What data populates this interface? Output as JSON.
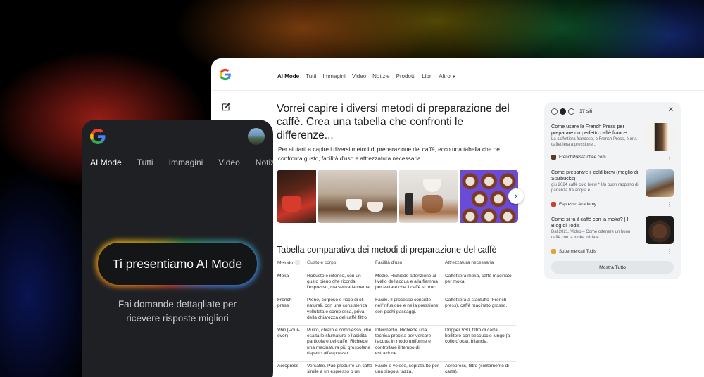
{
  "colors": {
    "accent_blue": "#4285f4",
    "accent_red": "#ea4335",
    "accent_yellow": "#fbbc04",
    "accent_green": "#34a853",
    "phone_bg": "#1f2023"
  },
  "desktop": {
    "nav_tabs": [
      "AI Mode",
      "Tutti",
      "Immagini",
      "Video",
      "Notizie",
      "Prodotti",
      "Libri",
      "Altro"
    ],
    "question": "Vorrei capire i diversi metodi di preparazione del caffè. Crea una tabella che confronti le differenze...",
    "intro": "Per aiutarti a capire i diversi metodi di preparazione del caffè, ecco una tabella che ne confronta gusto, facilità d'uso e attrezzatura necessaria.",
    "next_icon": "chevron-right-icon",
    "table_title": "Tabella comparativa dei metodi di preparazione del caffè",
    "table": {
      "headers": [
        "Metodo",
        "Gusto e corpo",
        "Facilità d'uso",
        "Attrezzatura necessaria"
      ],
      "rows": [
        [
          "Moka",
          "Robusto e intenso, con un gusto pieno che ricorda l'espresso, ma senza la crema.",
          "Medio. Richiede attenzione al livello dell'acqua e alla fiamma per evitare che il caffè si bruci.",
          "Caffettiera moka, caffè macinato per moka."
        ],
        [
          "French press",
          "Pieno, corposo e ricco di oli naturali, con una consistenza vellutata e complessa, priva della chiarezza del caffè filtro.",
          "Facile. Il processo consiste nell'infusione e nella pressione, con pochi passaggi.",
          "Caffettiera a stantuffo (French press), caffè macinato grosso."
        ],
        [
          "V60 (Pour-over)",
          "Pulito, chiaro e complesso, che esalta le sfumature e l'acidità particolare del caffè. Richiede una macinatura più grossolana rispetto all'espresso.",
          "Intermedio. Richiede una tecnica precisa per versare l'acqua in modo uniforme e controllare il tempo di estrazione.",
          "Dripper V60, filtro di carta, bollitore con beccuccio lungo (a collo d'oca), bilancia."
        ],
        [
          "Aeropress",
          "Versatile. Può produrre un caffè simile a un espresso o un",
          "Facile e veloce, soprattutto per una singola tazza.",
          "Aeropress, filtro (solitamente di carta)."
        ]
      ]
    },
    "sources": {
      "count_label": "17 siti",
      "items": [
        {
          "title": "Come usare la French Press per preparare un perfetto caffè france..",
          "snippet": "La caffettiera francese, o French Press, è una caffettiera a pressione...",
          "site": "FrenchPressCoffee.com"
        },
        {
          "title": "Come preparare il cold brew (meglio di Starbucks)",
          "snippet": "giu 2024 caffè cold brew * Un buon rapporto di partenza fra acqua e...",
          "site": "Espresso Academy..."
        },
        {
          "title": "Come si fa il caffè con la moka? | Il Blog di Todis",
          "snippet": "Dal 2021. Video – Come ottenere un buon caffè con la moka Iniziate...",
          "site": "Supermercati Todis"
        }
      ],
      "show_all": "Mostra Tutto"
    }
  },
  "phone": {
    "tabs": [
      "AI Mode",
      "Tutti",
      "Immagini",
      "Video",
      "Notizie"
    ],
    "cta": "Ti presentiamo AI Mode",
    "subtitle": "Fai domande dettagliate per ricevere risposte migliori"
  }
}
